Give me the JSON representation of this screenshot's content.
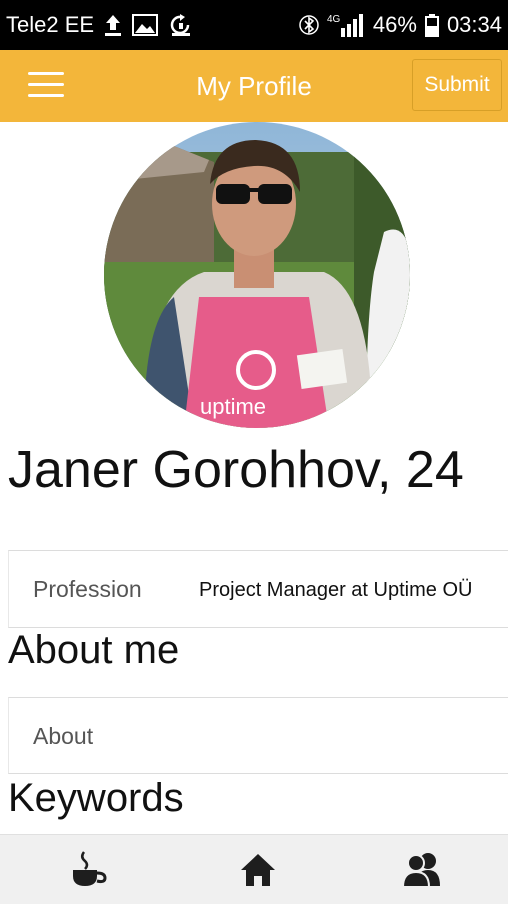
{
  "status_bar": {
    "carrier": "Tele2 EE",
    "network": "4G",
    "battery": "46%",
    "time": "03:34"
  },
  "toolbar": {
    "title": "My Profile",
    "submit_label": "Submit",
    "accent_color": "#f3b63a"
  },
  "profile": {
    "name_age": "Janer Gorohhov, 24",
    "profession": {
      "label": "Profession",
      "value": "Project Manager at Uptime OÜ"
    },
    "about": {
      "heading": "About me",
      "placeholder": "About"
    },
    "keywords": {
      "heading": "Keywords"
    }
  },
  "bottom_nav": [
    {
      "icon": "coffee-icon"
    },
    {
      "icon": "home-icon"
    },
    {
      "icon": "contacts-icon"
    }
  ]
}
